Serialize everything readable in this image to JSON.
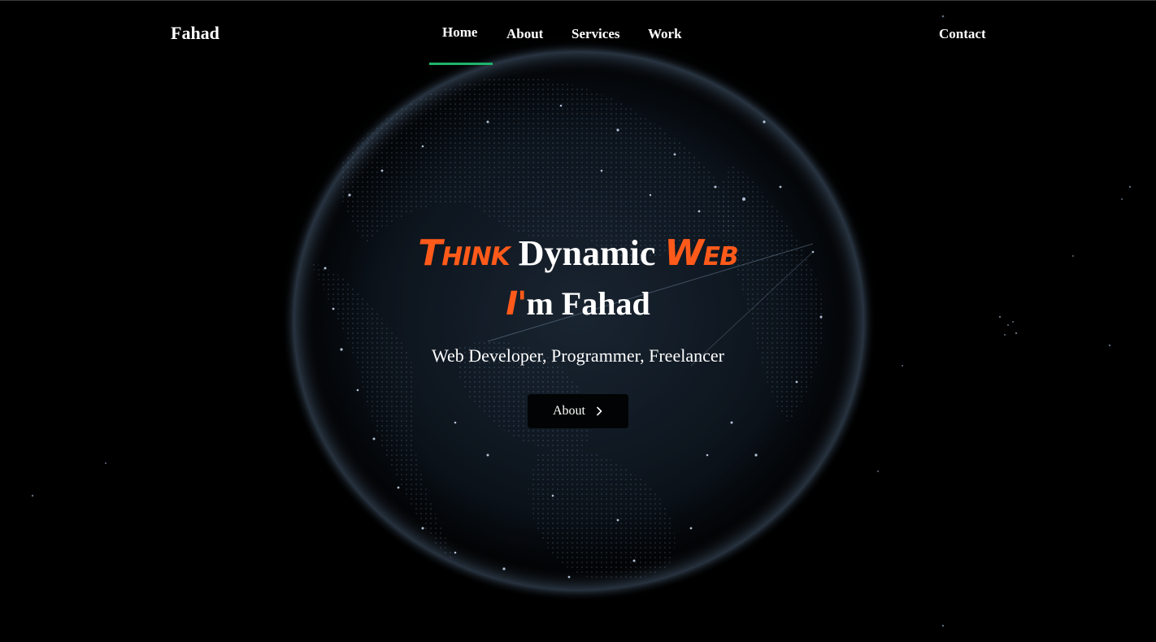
{
  "brand": "Fahad",
  "nav": {
    "home": "Home",
    "about": "About",
    "services": "Services",
    "work": "Work",
    "contact": "Contact",
    "active": "Home",
    "active_color": "#1fb36b"
  },
  "hero": {
    "word1": "Think",
    "word2": "Dynamic",
    "word3": "Web",
    "sub_prefix": "I'",
    "sub_rest": "m Fahad",
    "tagline": "Web Developer, Programmer, Freelancer",
    "button_label": "About",
    "button_icon": "chevron-right-icon",
    "accent_color": "#ff5a1a"
  },
  "background": {
    "image": "digital-globe",
    "color": "#000000"
  }
}
